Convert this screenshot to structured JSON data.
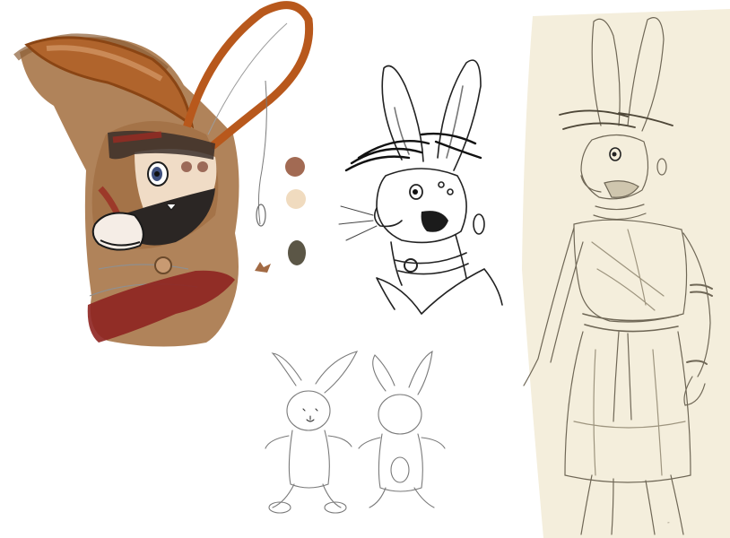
{
  "artwork": {
    "background": "#ffffff",
    "paper_tone": "#f4eedc",
    "pencil_color": "#6f6756",
    "ink_color": "#222222",
    "fur_brown": "#a9784c",
    "ear_orange": "#b8581c",
    "scarf_red": "#8e2420",
    "palette_swatches": [
      "#a26a53",
      "#f0dbbf",
      "#5b5646"
    ],
    "panels": [
      {
        "name": "painted-rabbit-head",
        "style": "digital colour sketch"
      },
      {
        "name": "inked-rabbit-bust",
        "style": "line art"
      },
      {
        "name": "rabbit-turnaround",
        "style": "pencil sketch"
      },
      {
        "name": "standing-rabbit-figure",
        "style": "pencil on paper"
      }
    ],
    "signature": "-"
  }
}
